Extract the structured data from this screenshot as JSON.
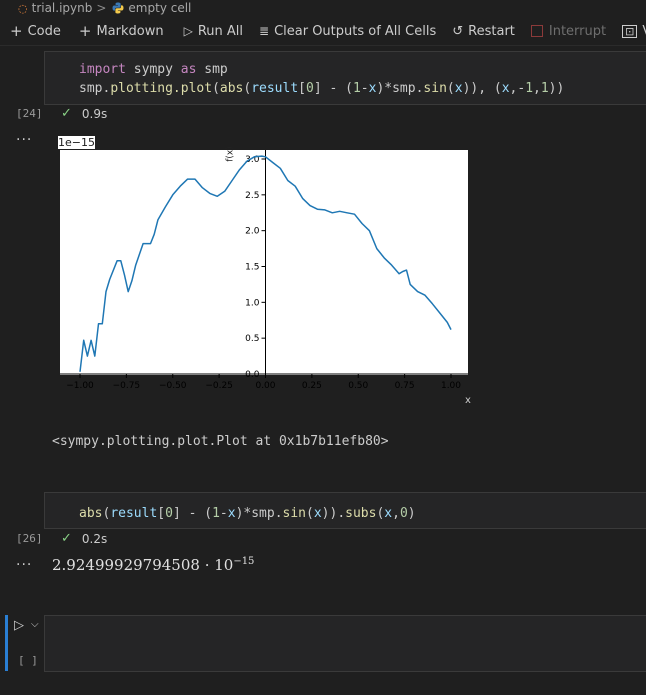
{
  "breadcrumb": {
    "file": "trial.ipynb",
    "separator": ">",
    "cell": "empty cell"
  },
  "toolbar": {
    "code": "Code",
    "markdown": "Markdown",
    "run_all": "Run All",
    "clear_outputs": "Clear Outputs of All Cells",
    "restart": "Restart",
    "interrupt": "Interrupt",
    "variables": "Va"
  },
  "cell1": {
    "count": "[24]",
    "line1": {
      "kw1": "import",
      "mod": " sympy ",
      "kw2": "as",
      "alias": " smp"
    },
    "line2": {
      "a": "smp.",
      "plot": "plotting.plot",
      "b": "(",
      "abs": "abs",
      "c": "(",
      "result": "result",
      "d": "[",
      "zero": "0",
      "e": "] - (",
      "one": "1",
      "f": "-",
      "x1": "x",
      "g": ")*smp.",
      "sin": "sin",
      "h": "(",
      "x2": "x",
      "i": ")), (",
      "x3": "x",
      "j": ",-",
      "one2": "1",
      "k": ",",
      "one3": "1",
      "l": "))"
    },
    "time": "0.9s",
    "output_repr": "<sympy.plotting.plot.Plot at 0x1b7b11efb80>"
  },
  "cell2": {
    "count": "[26]",
    "line": {
      "abs": "abs",
      "a": "(",
      "result": "result",
      "b": "[",
      "zero": "0",
      "c": "] - (",
      "one": "1",
      "d": "-",
      "x1": "x",
      "e": ")*smp.",
      "sin": "sin",
      "f": "(",
      "x2": "x",
      "g": ")).",
      "subs": "subs",
      "h": "(",
      "x3": "x",
      "i": ",",
      "zero2": "0",
      "j": ")"
    },
    "time": "0.2s",
    "result_mantissa": "2.92499929794508 · 10",
    "result_exponent": "−15"
  },
  "cell3": {
    "count": "[ ]"
  },
  "chart_data": {
    "type": "line",
    "title": "",
    "xlabel": "x",
    "ylabel": "f(x)",
    "offset_label": "1e−15",
    "xlim": [
      -1.0,
      1.0
    ],
    "ylim": [
      0.0,
      3.2
    ],
    "xticks": [
      -1.0,
      -0.75,
      -0.5,
      -0.25,
      0.0,
      0.25,
      0.5,
      0.75,
      1.0
    ],
    "xtick_labels": [
      "−1.00",
      "−0.75",
      "−0.50",
      "−0.25",
      "0.00",
      "0.25",
      "0.50",
      "0.75",
      "1.00"
    ],
    "yticks": [
      0.0,
      0.5,
      1.0,
      1.5,
      2.0,
      2.5,
      3.0
    ],
    "ytick_labels": [
      "0.0",
      "0.5",
      "1.0",
      "1.5",
      "2.0",
      "2.5",
      "3.0"
    ],
    "color": "#1f77b4",
    "x": [
      -1.0,
      -0.98,
      -0.96,
      -0.94,
      -0.92,
      -0.9,
      -0.88,
      -0.86,
      -0.84,
      -0.8,
      -0.78,
      -0.76,
      -0.74,
      -0.72,
      -0.7,
      -0.66,
      -0.62,
      -0.6,
      -0.58,
      -0.54,
      -0.5,
      -0.46,
      -0.42,
      -0.4,
      -0.38,
      -0.34,
      -0.3,
      -0.26,
      -0.22,
      -0.18,
      -0.14,
      -0.1,
      -0.06,
      -0.02,
      0.0,
      0.04,
      0.08,
      0.12,
      0.16,
      0.2,
      0.24,
      0.28,
      0.32,
      0.36,
      0.4,
      0.44,
      0.48,
      0.52,
      0.56,
      0.6,
      0.64,
      0.68,
      0.72,
      0.74,
      0.76,
      0.78,
      0.82,
      0.86,
      0.9,
      0.94,
      0.98,
      1.0
    ],
    "y": [
      0.03,
      0.47,
      0.25,
      0.47,
      0.25,
      0.7,
      0.7,
      1.15,
      1.32,
      1.58,
      1.58,
      1.38,
      1.15,
      1.3,
      1.52,
      1.82,
      1.82,
      1.95,
      2.15,
      2.33,
      2.5,
      2.62,
      2.72,
      2.72,
      2.72,
      2.6,
      2.52,
      2.48,
      2.55,
      2.7,
      2.85,
      2.97,
      3.03,
      3.04,
      3.03,
      2.95,
      2.87,
      2.7,
      2.62,
      2.45,
      2.35,
      2.3,
      2.29,
      2.25,
      2.27,
      2.25,
      2.23,
      2.1,
      2.0,
      1.75,
      1.62,
      1.52,
      1.4,
      1.43,
      1.45,
      1.25,
      1.15,
      1.1,
      0.98,
      0.85,
      0.72,
      0.62
    ]
  }
}
